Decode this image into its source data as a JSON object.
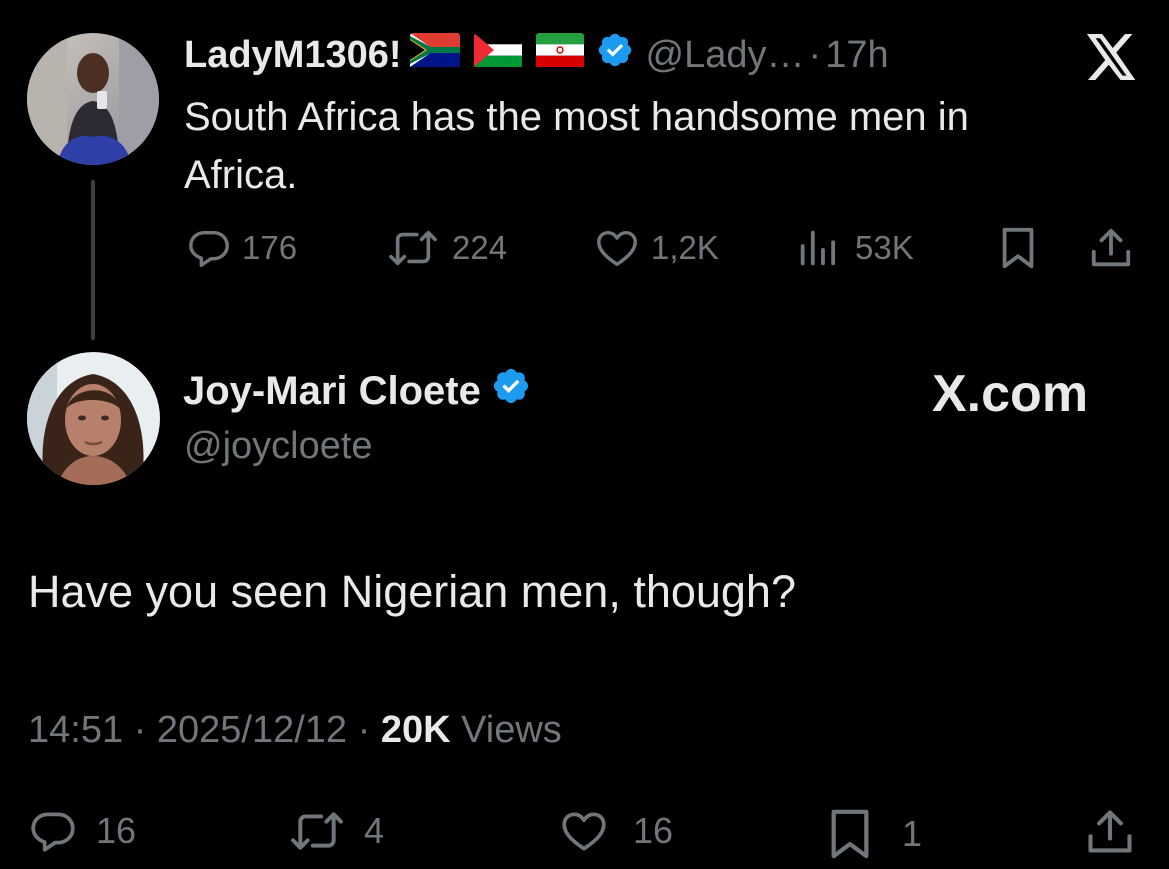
{
  "quoted_post": {
    "display_name": "LadyM1306!",
    "handle": "@Lady…",
    "separator": "·",
    "time": "17h",
    "text_line1": "South Africa has the most handsome men in",
    "text_line2": "Africa.",
    "flags": [
      "south-africa-flag-icon",
      "palestine-flag-icon",
      "iran-flag-icon"
    ],
    "stats": {
      "replies": "176",
      "reposts": "224",
      "likes": "1,2K",
      "views": "53K"
    }
  },
  "main_post": {
    "display_name": "Joy-Mari Cloete",
    "handle": "@joycloete",
    "watermark": "X.com",
    "text": "Have you seen Nigerian men, though?",
    "time": "14:51",
    "date": "2025/12/12",
    "dot": "·",
    "views_count": "20K",
    "views_label": "Views",
    "stats": {
      "replies": "16",
      "reposts": "4",
      "likes": "16",
      "bookmarks": "1"
    }
  },
  "colors": {
    "background": "#000000",
    "text": "#e7e9ea",
    "muted": "#71767b",
    "verified": "#1d9bf0"
  }
}
